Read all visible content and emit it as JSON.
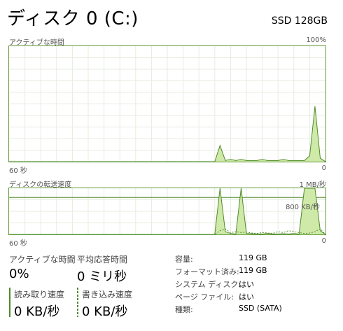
{
  "header": {
    "title": "ディスク 0 (C:)",
    "model": "SSD 128GB"
  },
  "activity_chart": {
    "title": "アクティブな時間",
    "max_label": "100%",
    "x_left_label": "60 秒",
    "x_right_label": "0"
  },
  "transfer_chart": {
    "title": "ディスクの転送速度",
    "max_label": "1 MB/秒",
    "line_label": "800 KB/秒",
    "x_left_label": "60 秒",
    "x_right_label": "0"
  },
  "stats": {
    "active_time": {
      "label": "アクティブな時間",
      "value": "0%"
    },
    "avg_response": {
      "label": "平均応答時間",
      "value": "0 ミリ秒"
    },
    "read_speed": {
      "label": "読み取り速度",
      "value": "0 KB/秒"
    },
    "write_speed": {
      "label": "書き込み速度",
      "value": "0 KB/秒"
    }
  },
  "properties": [
    {
      "key": "容量:",
      "value": "119 GB"
    },
    {
      "key": "フォーマット済み:",
      "value": "119 GB"
    },
    {
      "key": "システム ディスク:",
      "value": "はい"
    },
    {
      "key": "ページ ファイル:",
      "value": "はい"
    },
    {
      "key": "種類:",
      "value": "SSD (SATA)"
    }
  ],
  "colors": {
    "accent": "#4f8a2a",
    "fill": "#cfe9a8",
    "grid": "#e6ecdf"
  },
  "chart_data": [
    {
      "type": "area",
      "title": "アクティブな時間",
      "xlim": [
        60,
        0
      ],
      "ylim": [
        0,
        100
      ],
      "x": [
        60,
        21,
        20,
        19,
        18,
        17,
        16,
        15,
        14,
        13,
        12,
        11,
        10,
        9,
        8,
        7,
        6,
        5,
        4,
        3,
        2,
        1,
        0
      ],
      "series": [
        {
          "values": [
            0,
            0,
            14,
            1,
            2,
            1,
            2,
            1,
            1,
            1,
            2,
            1,
            1,
            1,
            2,
            1,
            1,
            1,
            1,
            5,
            48,
            3,
            0
          ]
        }
      ]
    },
    {
      "type": "area",
      "title": "ディスクの転送速度",
      "xlim": [
        60,
        0
      ],
      "ylim": [
        0,
        1000
      ],
      "reference_line": 800,
      "x": [
        60,
        21,
        20,
        19,
        18,
        17,
        16,
        15,
        14,
        13,
        12,
        11,
        10,
        9,
        8,
        7,
        6,
        5,
        4,
        3,
        2,
        1,
        0
      ],
      "series": [
        {
          "name": "読み取り速度",
          "values": [
            0,
            0,
            1000,
            60,
            20,
            10,
            1000,
            20,
            15,
            10,
            10,
            20,
            10,
            10,
            15,
            10,
            20,
            10,
            1000,
            1000,
            1000,
            80,
            0
          ]
        },
        {
          "name": "書き込み速度",
          "values": [
            0,
            0,
            80,
            120,
            40,
            60,
            40,
            50,
            30,
            20,
            40,
            30,
            20,
            60,
            40,
            80,
            60,
            40,
            20,
            30,
            60,
            120,
            0
          ]
        }
      ]
    }
  ]
}
